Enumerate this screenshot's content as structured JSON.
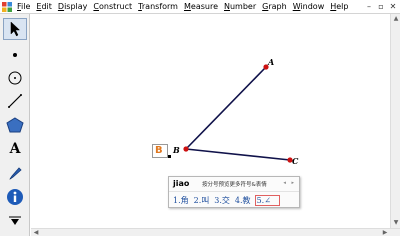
{
  "menu": {
    "items": [
      {
        "u": "F",
        "rest": "ile"
      },
      {
        "u": "E",
        "rest": "dit"
      },
      {
        "u": "D",
        "rest": "isplay"
      },
      {
        "u": "C",
        "rest": "onstruct"
      },
      {
        "u": "T",
        "rest": "ransform"
      },
      {
        "u": "M",
        "rest": "easure"
      },
      {
        "u": "N",
        "rest": "umber"
      },
      {
        "u": "G",
        "rest": "raph"
      },
      {
        "u": "W",
        "rest": "indow"
      },
      {
        "u": "H",
        "rest": "elp"
      }
    ]
  },
  "window_controls": {
    "minimize": "–",
    "restore": "▫",
    "close": "✕"
  },
  "tools": [
    {
      "name": "arrow-tool-icon"
    },
    {
      "name": "point-tool-icon"
    },
    {
      "name": "compass-tool-icon"
    },
    {
      "name": "straightedge-tool-icon"
    },
    {
      "name": "polygon-tool-icon"
    },
    {
      "name": "text-tool-icon",
      "glyph": "A"
    },
    {
      "name": "marker-tool-icon"
    },
    {
      "name": "information-tool-icon"
    },
    {
      "name": "custom-tool-icon"
    }
  ],
  "points": {
    "A": {
      "label": "A",
      "color": "#cc1111"
    },
    "B": {
      "label": "B",
      "color": "#cc1111"
    },
    "C": {
      "label": "C",
      "color": "#cc1111"
    }
  },
  "segment_color": "#10124a",
  "ime_edit": {
    "text": "B"
  },
  "ime": {
    "pinyin": "jiao",
    "hint": "按分号预览更多符号&表情",
    "nav": "◂ ▸",
    "candidates": [
      {
        "label": "1.角"
      },
      {
        "label": "2.叫"
      },
      {
        "label": "3.交"
      },
      {
        "label": "4.教"
      },
      {
        "label": "5.∠"
      }
    ]
  }
}
